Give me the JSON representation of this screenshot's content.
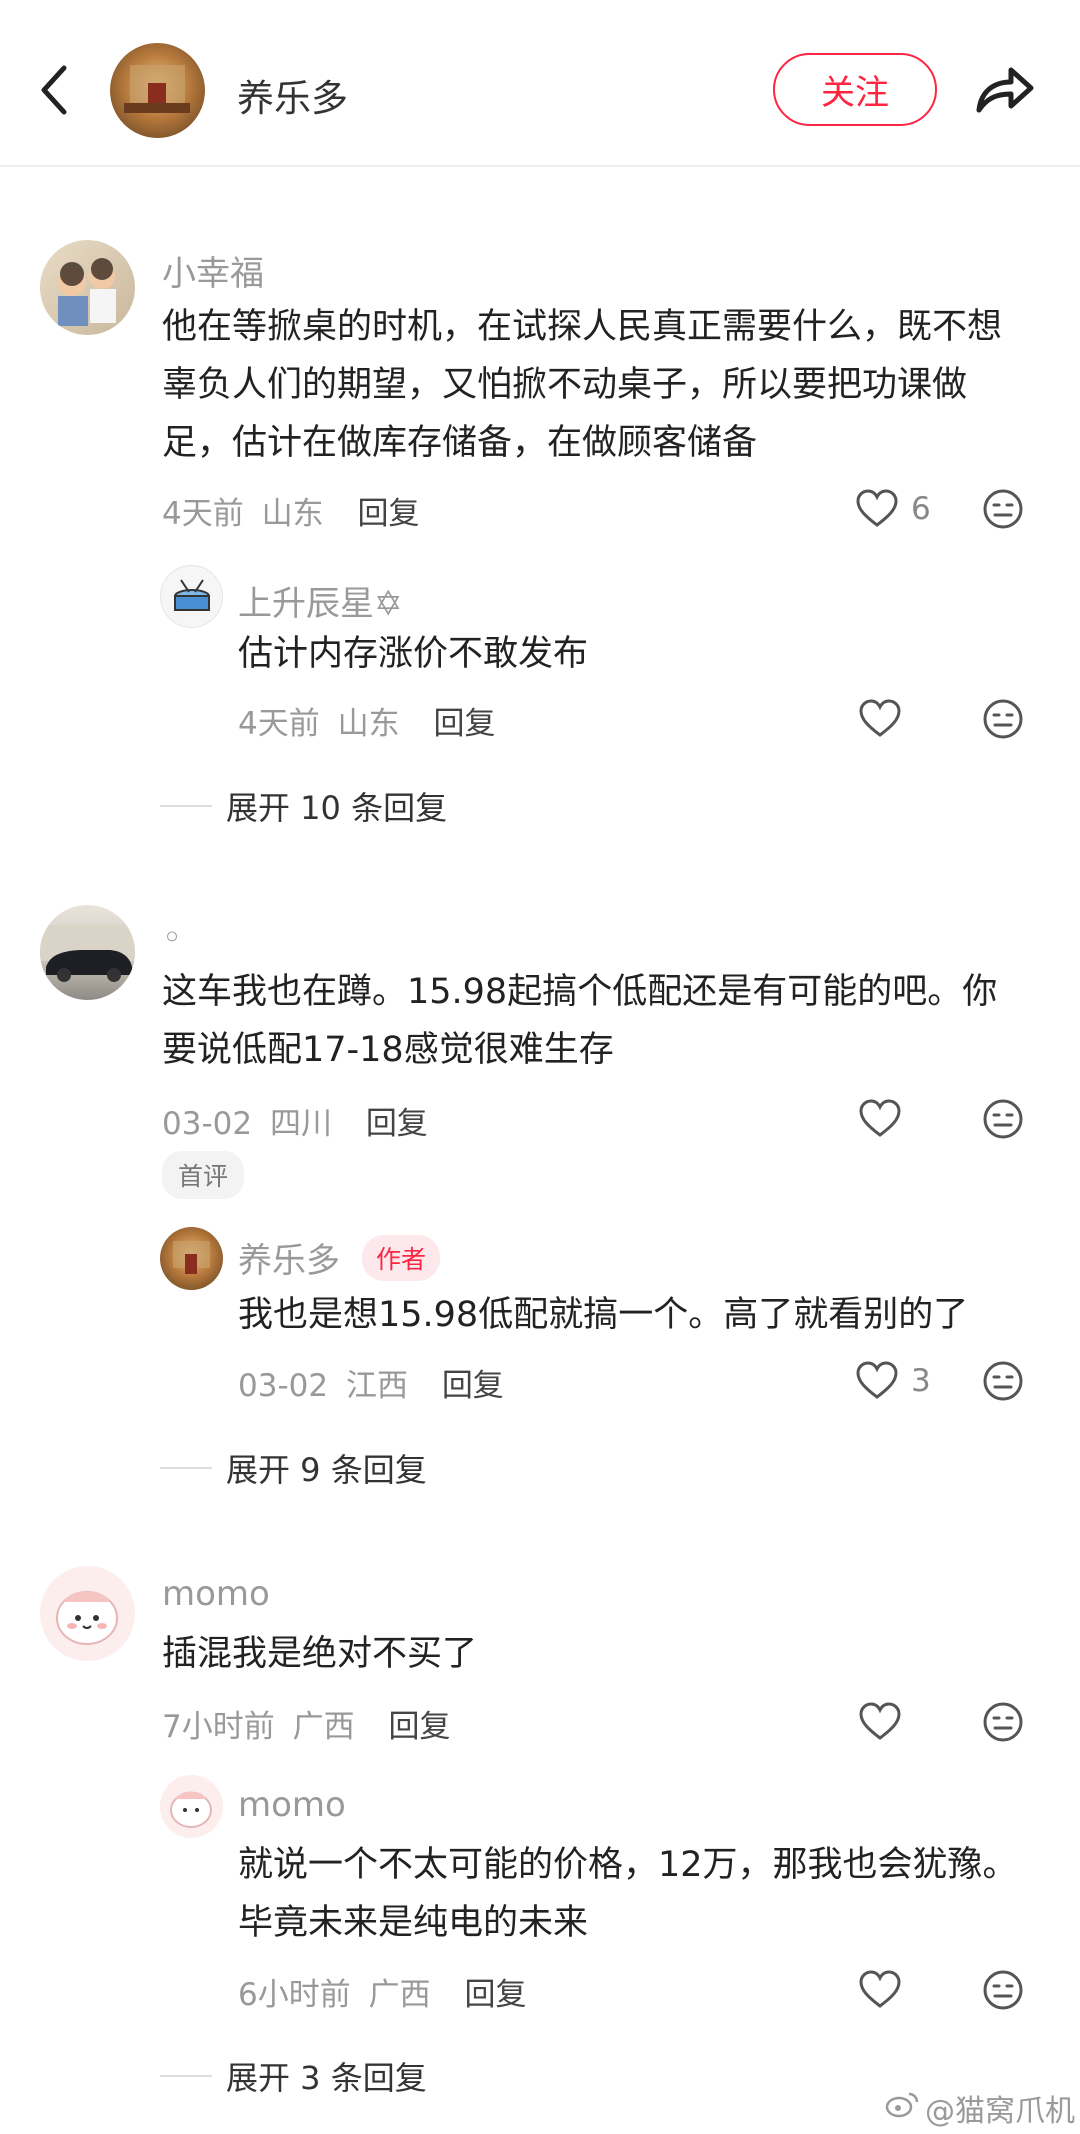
{
  "header": {
    "title": "养乐多",
    "follow_label": "关注",
    "accent_color": "#ff2442"
  },
  "comments": [
    {
      "user": "小幸福",
      "text": "他在等掀桌的时机，在试探人民真正需要什么，既不想辜负人们的期望，又怕掀不动桌子，所以要把功课做足，估计在做库存储备，在做顾客储备",
      "time": "4天前",
      "location": "山东",
      "reply_label": "回复",
      "likes": "6",
      "replies": [
        {
          "user": "上升辰星✡",
          "text": "估计内存涨价不敢发布",
          "time": "4天前",
          "location": "山东",
          "reply_label": "回复"
        }
      ],
      "expand_label": "展开 10 条回复"
    },
    {
      "user": "◦",
      "text": "这车我也在蹲。15.98起搞个低配还是有可能的吧。你要说低配17-18感觉很难生存",
      "time": "03-02",
      "location": "四川",
      "reply_label": "回复",
      "badge": "首评",
      "replies": [
        {
          "user": "养乐多",
          "author_badge": "作者",
          "text": "我也是想15.98低配就搞一个。高了就看别的了",
          "time": "03-02",
          "location": "江西",
          "reply_label": "回复",
          "likes": "3"
        }
      ],
      "expand_label": "展开 9 条回复"
    },
    {
      "user": "momo",
      "text": "插混我是绝对不买了",
      "time": "7小时前",
      "location": "广西",
      "reply_label": "回复",
      "replies": [
        {
          "user": "momo",
          "text": "就说一个不太可能的价格，12万，那我也会犹豫。毕竟未来是纯电的未来",
          "time": "6小时前",
          "location": "广西",
          "reply_label": "回复"
        }
      ],
      "expand_label": "展开 3 条回复"
    }
  ],
  "watermark": "@猫窝爪机"
}
